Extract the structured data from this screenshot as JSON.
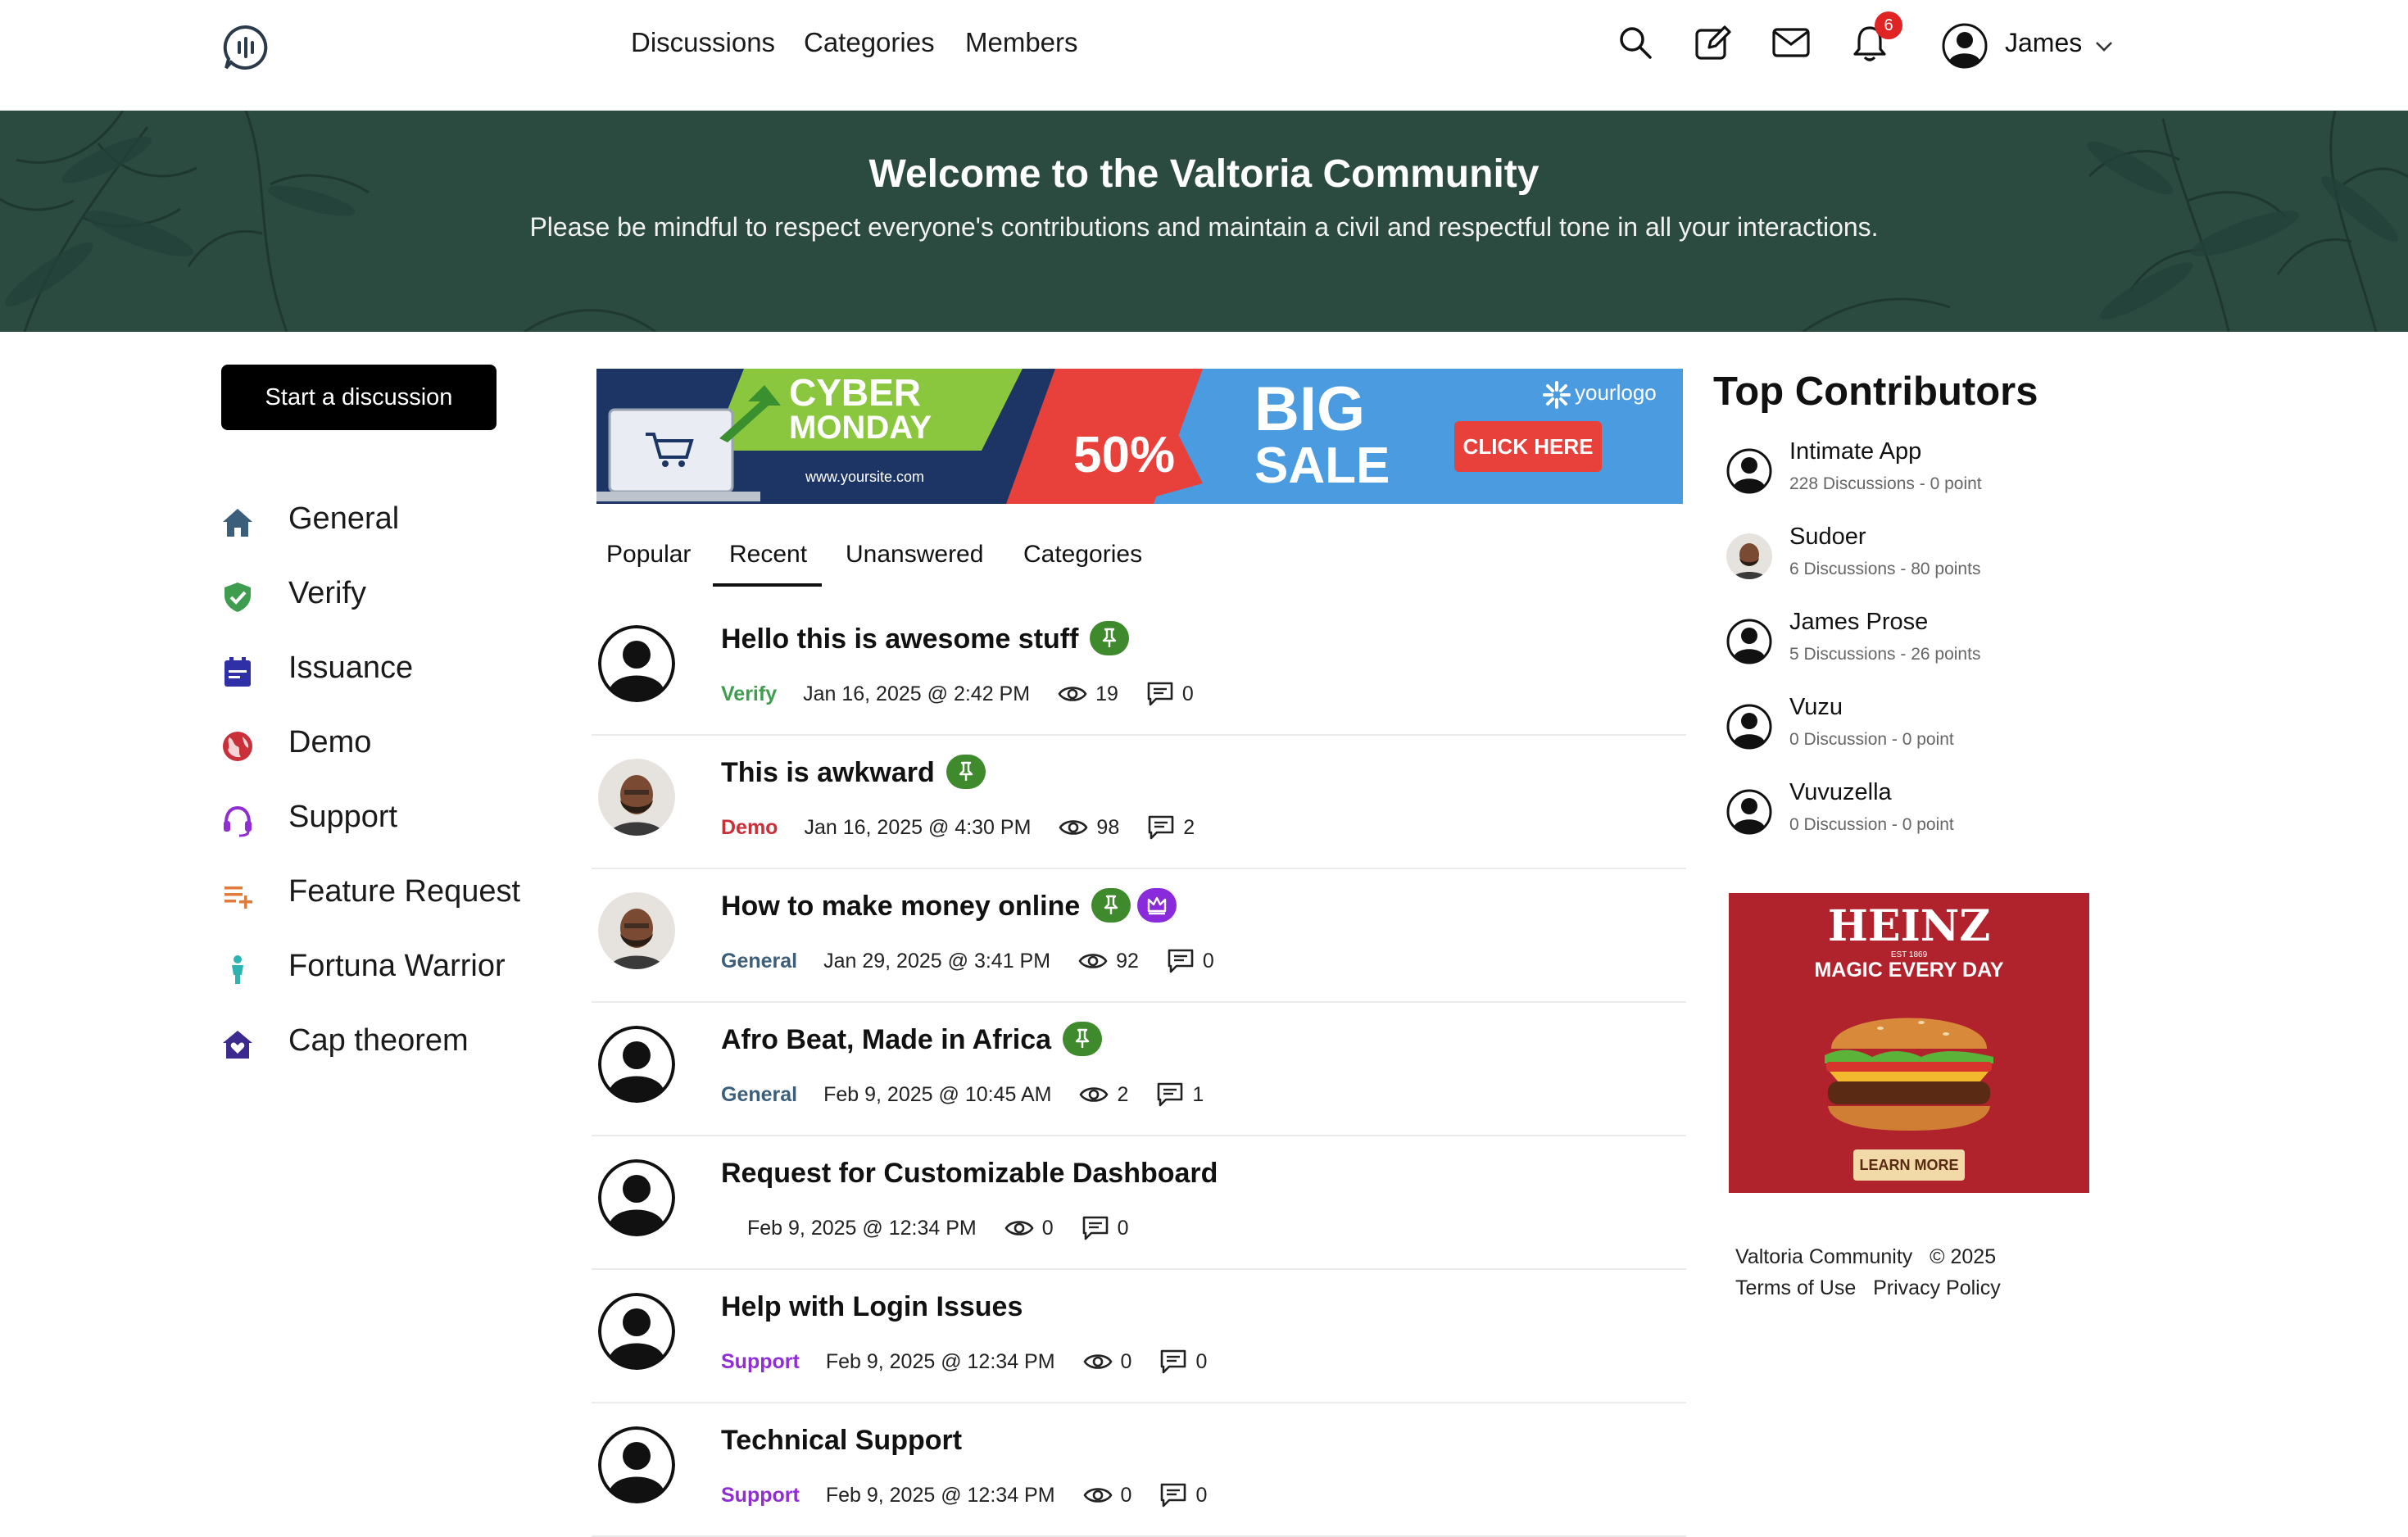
{
  "header": {
    "nav": [
      "Discussions",
      "Categories",
      "Members"
    ],
    "notifications_count": "6",
    "user_name": "James"
  },
  "banner": {
    "title": "Welcome to the Valtoria Community",
    "subtitle": "Please be mindful to respect everyone's contributions and maintain a civil and respectful tone in all your interactions."
  },
  "sidebar": {
    "start_button": "Start a discussion",
    "categories": [
      {
        "label": "General",
        "icon": "home-icon",
        "color": "#3b5e7a"
      },
      {
        "label": "Verify",
        "icon": "shield-check-icon",
        "color": "#3f9d4f"
      },
      {
        "label": "Issuance",
        "icon": "calendar-icon",
        "color": "#2f2fa8"
      },
      {
        "label": "Demo",
        "icon": "globe-icon",
        "color": "#c9303a"
      },
      {
        "label": "Support",
        "icon": "headset-icon",
        "color": "#8f2fd1"
      },
      {
        "label": "Feature Request",
        "icon": "list-add-icon",
        "color": "#e07b39"
      },
      {
        "label": "Fortuna Warrior",
        "icon": "person-icon",
        "color": "#2fb3b0"
      },
      {
        "label": "Cap theorem",
        "icon": "house-heart-icon",
        "color": "#3c2a8f"
      }
    ]
  },
  "ads": {
    "top": {
      "line1": "CYBER",
      "line2": "MONDAY",
      "url": "www.yoursite.com",
      "discount": "50%",
      "big": "BIG",
      "sale": "SALE",
      "cta": "CLICK HERE",
      "logo": "yourlogo"
    },
    "side": {
      "brand": "HEINZ",
      "est": "EST 1869",
      "tagline": "MAGIC EVERY DAY",
      "cta": "LEARN MORE"
    }
  },
  "tabs": [
    "Popular",
    "Recent",
    "Unanswered",
    "Categories"
  ],
  "active_tab": "Recent",
  "discussions": [
    {
      "title": "Hello this is awesome stuff",
      "category": "Verify",
      "category_color": "#3f9d4f",
      "date": "Jan 16, 2025 @ 2:42 PM",
      "views": "19",
      "comments": "0",
      "pinned": true,
      "avatar": "default"
    },
    {
      "title": "This is awkward",
      "category": "Demo",
      "category_color": "#c9303a",
      "date": "Jan 16, 2025 @ 4:30 PM",
      "views": "98",
      "comments": "2",
      "pinned": true,
      "avatar": "photo"
    },
    {
      "title": "How to make money online",
      "category": "General",
      "category_color": "#3b5e7a",
      "date": "Jan 29, 2025 @ 3:41 PM",
      "views": "92",
      "comments": "0",
      "pinned": true,
      "crown": true,
      "avatar": "photo"
    },
    {
      "title": "Afro Beat, Made in Africa",
      "category": "General",
      "category_color": "#3b5e7a",
      "date": "Feb 9, 2025 @ 10:45 AM",
      "views": "2",
      "comments": "1",
      "pinned": true,
      "avatar": "default"
    },
    {
      "title": "Request for Customizable Dashboard",
      "category": "",
      "category_color": "#000000",
      "date": "Feb 9, 2025 @ 12:34 PM",
      "views": "0",
      "comments": "0",
      "pinned": false,
      "avatar": "default"
    },
    {
      "title": "Help with Login Issues",
      "category": "Support",
      "category_color": "#8f2fd1",
      "date": "Feb 9, 2025 @ 12:34 PM",
      "views": "0",
      "comments": "0",
      "pinned": false,
      "avatar": "default"
    },
    {
      "title": "Technical Support",
      "category": "Support",
      "category_color": "#8f2fd1",
      "date": "Feb 9, 2025 @ 12:34 PM",
      "views": "0",
      "comments": "0",
      "pinned": false,
      "avatar": "default"
    }
  ],
  "top_contributors": {
    "title": "Top Contributors",
    "items": [
      {
        "name": "Intimate App",
        "stats": "228 Discussions  - 0 point",
        "avatar": "default"
      },
      {
        "name": "Sudoer",
        "stats": "6 Discussions  - 80 points",
        "avatar": "photo"
      },
      {
        "name": "James Prose",
        "stats": "5 Discussions  - 26 points",
        "avatar": "default"
      },
      {
        "name": "Vuzu",
        "stats": "0 Discussion  - 0 point",
        "avatar": "default"
      },
      {
        "name": "Vuvuzella",
        "stats": "0 Discussion  - 0 point",
        "avatar": "default"
      }
    ]
  },
  "footer": {
    "brand": "Valtoria Community",
    "copyright": "© 2025",
    "terms": "Terms of Use",
    "privacy": "Privacy Policy"
  }
}
